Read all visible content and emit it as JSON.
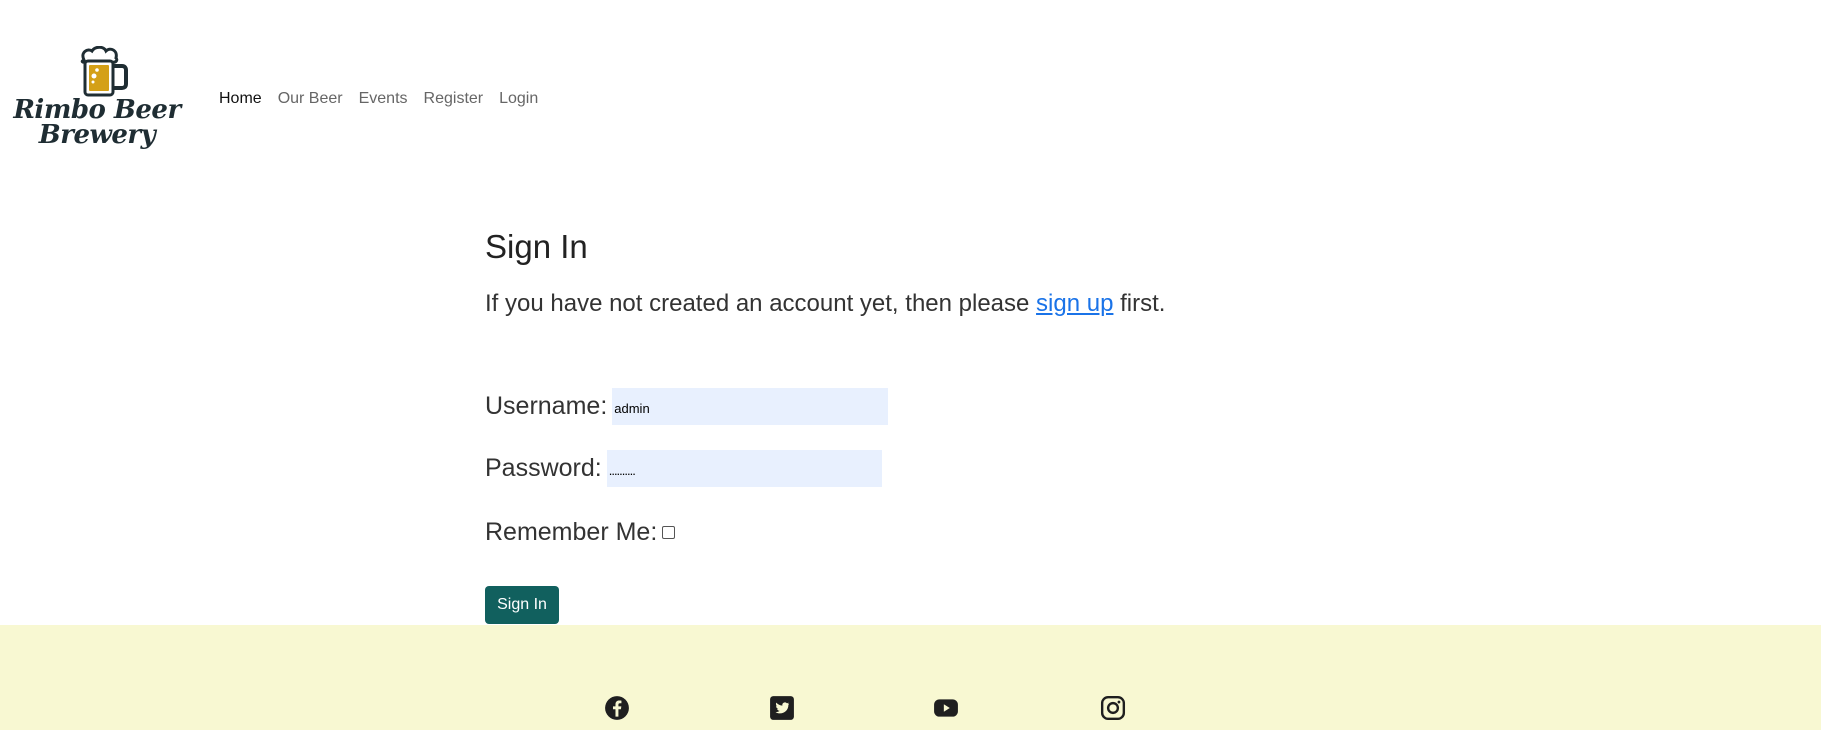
{
  "brand": {
    "name_line1": "Rimbo Beer",
    "name_line2": "Brewery",
    "icon": "beer-mug-icon",
    "mug_color": "#d4a017"
  },
  "nav": {
    "items": [
      {
        "label": "Home",
        "active": true
      },
      {
        "label": "Our Beer",
        "active": false
      },
      {
        "label": "Events",
        "active": false
      },
      {
        "label": "Register",
        "active": false
      },
      {
        "label": "Login",
        "active": false
      }
    ]
  },
  "page": {
    "title": "Sign In",
    "intro_before": "If you have not created an account yet, then please ",
    "intro_link": "sign up",
    "intro_after": " first."
  },
  "form": {
    "username_label": "Username:",
    "username_value": "admin",
    "password_label": "Password:",
    "password_value": "..........",
    "remember_label": "Remember Me:",
    "remember_checked": false,
    "submit_label": "Sign In"
  },
  "footer": {
    "background": "#f8f8d2",
    "social_icons": [
      "facebook-icon",
      "twitter-icon",
      "youtube-icon",
      "instagram-icon"
    ]
  },
  "colors": {
    "primary_button": "#11605e",
    "link": "#1a73e8",
    "input_bg": "#e8f0fe"
  }
}
